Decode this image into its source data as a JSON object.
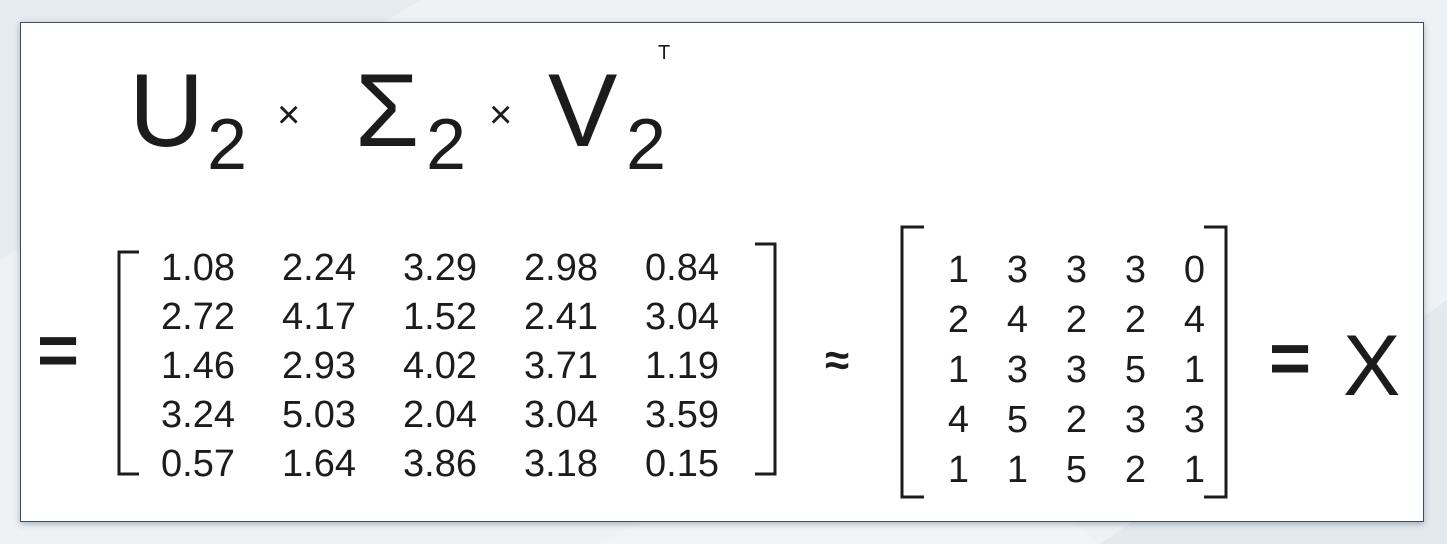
{
  "formula": {
    "u": "U",
    "u_sub": "2",
    "times_1": "×",
    "sigma": "Σ",
    "sigma_sub": "2",
    "times_2": "×",
    "v": "V",
    "v_sub": "2",
    "v_sup": "T"
  },
  "equation": {
    "equals_1": "=",
    "approx": "≈",
    "equals_2": "=",
    "x": "X"
  },
  "matrix_approx": [
    [
      "1.08",
      "2.24",
      "3.29",
      "2.98",
      "0.84"
    ],
    [
      "2.72",
      "4.17",
      "1.52",
      "2.41",
      "3.04"
    ],
    [
      "1.46",
      "2.93",
      "4.02",
      "3.71",
      "1.19"
    ],
    [
      "3.24",
      "5.03",
      "2.04",
      "3.04",
      "3.59"
    ],
    [
      "0.57",
      "1.64",
      "3.86",
      "3.18",
      "0.15"
    ]
  ],
  "matrix_x": [
    [
      "1",
      "3",
      "3",
      "3",
      "0"
    ],
    [
      "2",
      "4",
      "2",
      "2",
      "4"
    ],
    [
      "1",
      "3",
      "3",
      "5",
      "1"
    ],
    [
      "4",
      "5",
      "2",
      "3",
      "3"
    ],
    [
      "1",
      "1",
      "5",
      "2",
      "1"
    ]
  ],
  "colors": {
    "text": "#1c1c1c",
    "card_border": "#3b4f63",
    "background": "#eef2f5"
  }
}
